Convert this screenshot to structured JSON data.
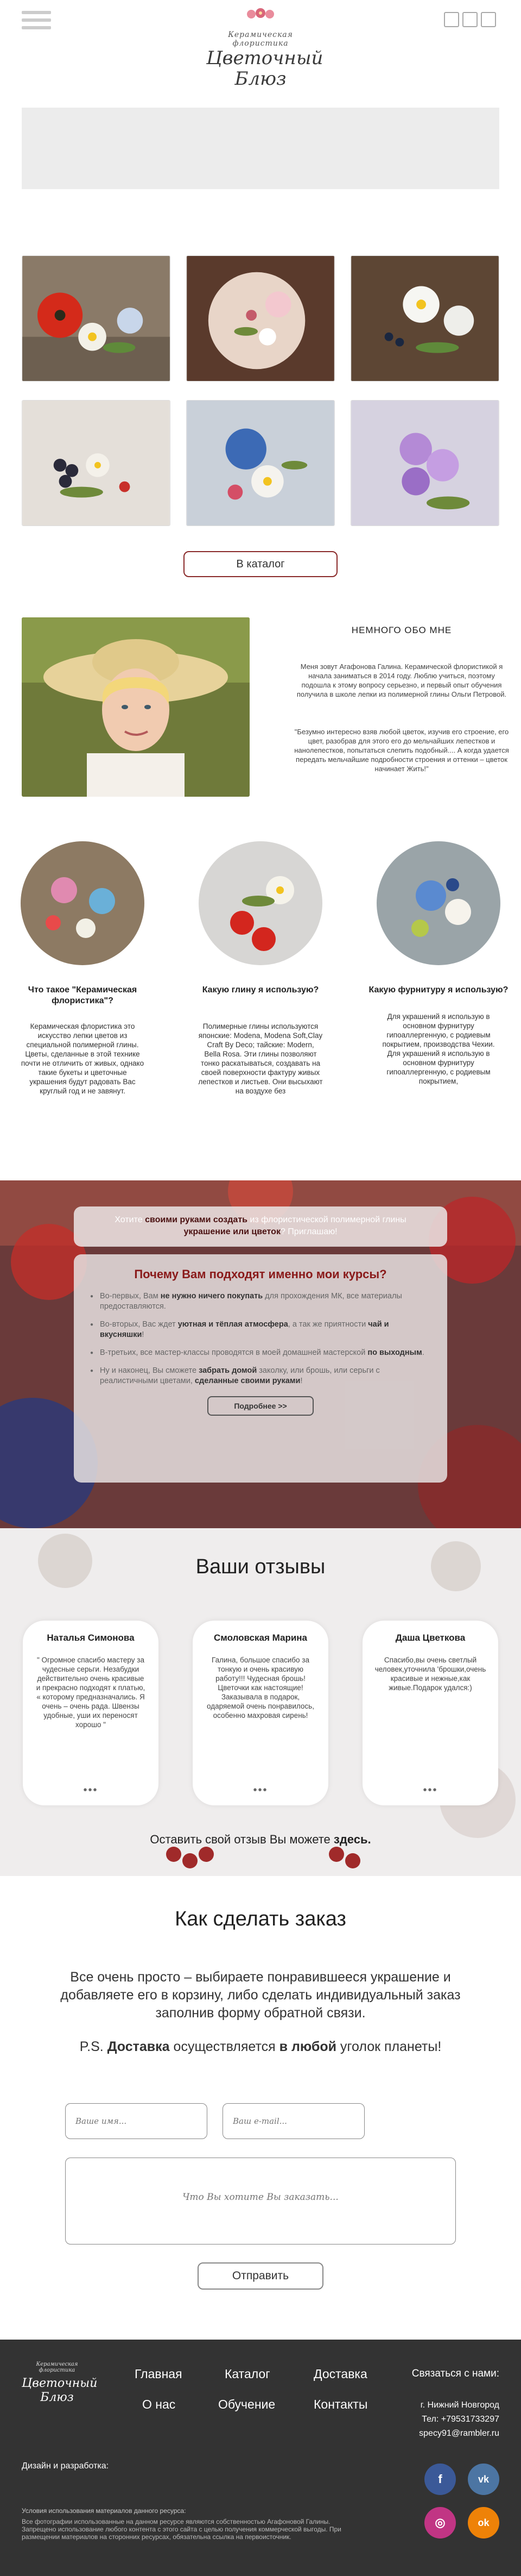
{
  "header": {
    "logo_subtitle": "Керамическая флористика",
    "logo_title": "Цветочный Блюз"
  },
  "gallery": {
    "button": "В каталог"
  },
  "about": {
    "title": "НЕМНОГО ОБО МНЕ",
    "paragraph1": "Меня зовут Агафонова Галина. Керамической флористикой я начала заниматься в 2014 году. Люблю учиться, поэтому подошла к этому вопросу серьезно, и первый опыт обучения получила в школе лепки из полимерной глины Ольги Петровой.",
    "paragraph2": "\"Безумно интересно взяв любой цветок, изучив его строение, его цвет, разобрав для этого его до мельчайших лепестков и нанолепестков, попытаться слепить подобный.... А когда удается передать мельчайшие подробности строения и оттенки – цветок начинает Жить!\""
  },
  "features": [
    {
      "title": "Что такое \"Керамическая флористика\"?",
      "text": "Керамическая флористика это искусство лепки цветов из специальной полимерной глины.\nЦветы, сделанные в этой технике почти не отличить от живых, однако такие букеты и цветочные украшения будут радовать Вас круглый год и не завянут."
    },
    {
      "title": "Какую глину я использую?",
      "text": "Полимерные глины используются японские: Modena, Modena Soft,Clay Craft By Deco; тайские: Modern, Bella Rosa. Эти глины позволяют тонко раскатываться, создавать на своей поверхности фактуру живых лепестков и листьев. Они высыхают на воздухе без"
    },
    {
      "title": "Какую фурнитуру я использую?",
      "text": "Для украшений я использую в основном фурнитуру гипоаллергенную, с родиевым покрытием, производства Чехии. Для украшений я использую в основном фурнитуру гипоаллергенную, с родиевым покрытием,"
    }
  ],
  "why": {
    "top_pre": "Хотите ",
    "top_b1": "своими руками создать",
    "top_mid": " из флористической полимерной глины ",
    "top_b2": "украшение или цветок",
    "top_post": "? Приглашаю!",
    "heading": "Почему Вам подходят именно мои курсы?",
    "items": [
      {
        "pre": "Во-первых, Вам ",
        "b": "не нужно ничего покупать",
        "post": " для прохождения МК, все материалы предоставляются."
      },
      {
        "pre": "Во-вторых, Вас ждет ",
        "b": "уютная и тёплая атмосфера",
        "post": ", а так же  приятности ",
        "b2": "чай и вкусняшки",
        "post2": "!"
      },
      {
        "pre": "В-третьих, все мастер-классы проводятся в моей домашней мастерской ",
        "b": "по выходным",
        "post": "."
      },
      {
        "pre": "Ну и наконец, Вы сможете ",
        "b": "забрать домой",
        "post": " заколку, или брошь, или серьги с реалистичными цветами, ",
        "b2": "сделанные своими руками",
        "post2": "!"
      }
    ],
    "button": "Подробнее >>"
  },
  "reviews": {
    "title": "Ваши отзывы",
    "items": [
      {
        "name": "Наталья Симонова",
        "text": "\" Огромное спасибо мастеру за чудесные серьги. Незабудки действительно очень красивые и прекрасно подходят к платью,\n« которому предназначались. Я очень – очень рада. Швензы удобные, уши их переносят хорошо \"",
        "dots": "•••"
      },
      {
        "name": "Смоловская Марина",
        "text": "Галина, большое спасибо за тонкую и очень красивую работу!!! Чудесная брошь! Цветочки как настоящие! Заказывала в подарок, одаряемой очень понравилось, особенно махровая сирень!",
        "dots": "•••"
      },
      {
        "name": "Даша Цветкова",
        "text": "Спасибо,вы очень светлый человек,уточнила 'брошки,очень красивые и нежные,как живые.Подарок удался:)",
        "dots": "•••"
      }
    ],
    "leave_pre": "Оставить свой отзыв Вы можете ",
    "leave_link": "здесь."
  },
  "order": {
    "title": "Как сделать заказ",
    "text": "Все очень просто – выбираете понравившееся украшение и добавляете его в корзину, либо сделать индивидуальный заказ заполнив форму обратной связи.",
    "ps_pre": "P.S. ",
    "ps_b1": "Доставка",
    "ps_mid": " осуществляется ",
    "ps_b2": "в любой",
    "ps_post": " уголок планеты!",
    "name_placeholder": "Ваше имя...",
    "email_placeholder": "Ваш e-mail...",
    "message_placeholder": "Что Вы хотите Вы заказать...",
    "submit": "Отправить"
  },
  "footer": {
    "logo_subtitle": "Керамическая флористика",
    "logo_title": "Цветочный Блюз",
    "nav": [
      "Главная",
      "Каталог",
      "Доставка",
      "О нас",
      "Обучение",
      "Контакты"
    ],
    "contact_title": "Связаться с нами:",
    "city": "г. Нижний Новгород",
    "phone": "Тел: +79531733297",
    "email": "specy91@rambler.ru",
    "design": "Дизайн и разработка:",
    "terms_title": "Условия использования материалов данного ресурса:",
    "terms_text": "Все фотографии использованные на данном ресурсе являются собственностью Агафоновой Галины. Запрещено использование любого контента с этого сайта с целью получения коммерческой выгоды. При размещении материалов на сторонних ресурсах, обязательна ссылка на первоисточник.",
    "socials": [
      {
        "icon": "facebook-icon",
        "glyph": "f",
        "color": "#3b5998"
      },
      {
        "icon": "vk-icon",
        "glyph": "vk",
        "color": "#4c75a3"
      },
      {
        "icon": "instagram-icon",
        "glyph": "◎",
        "color": "#c13584"
      },
      {
        "icon": "odnoklassniki-icon",
        "glyph": "ok",
        "color": "#ee8208"
      }
    ]
  }
}
